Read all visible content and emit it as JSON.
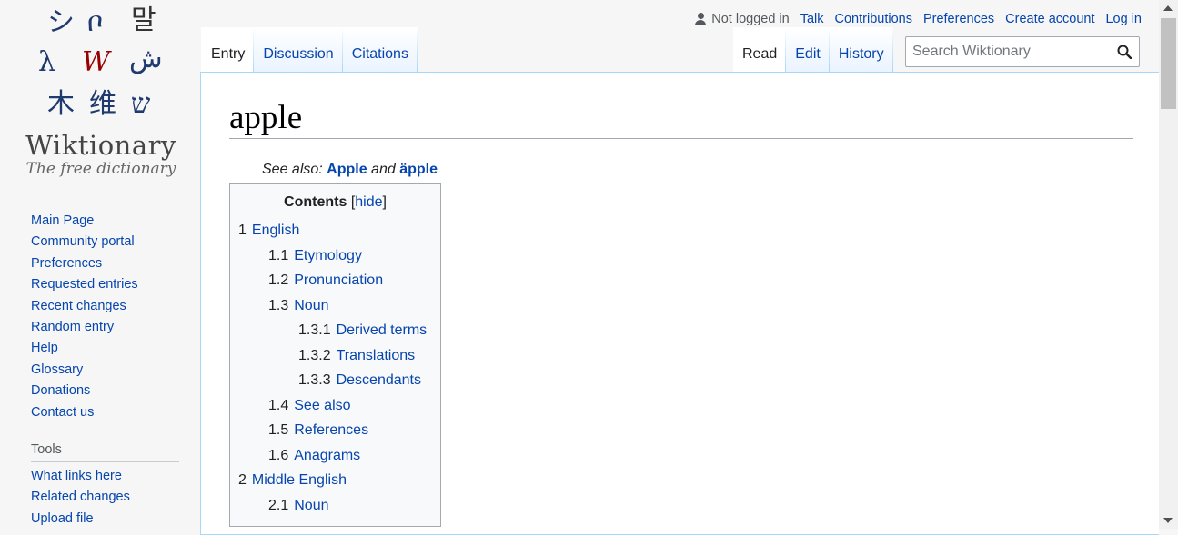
{
  "logo": {
    "glyphs": [
      "シ",
      "ቦ",
      "말",
      "λ",
      "W",
      "ش",
      "木",
      "维",
      "ש"
    ],
    "wordmark": "Wiktionary",
    "tagline": "The free dictionary"
  },
  "sidebar": {
    "navigation": [
      "Main Page",
      "Community portal",
      "Preferences",
      "Requested entries",
      "Recent changes",
      "Random entry",
      "Help",
      "Glossary",
      "Donations",
      "Contact us"
    ],
    "tools_heading": "Tools",
    "tools": [
      "What links here",
      "Related changes",
      "Upload file"
    ]
  },
  "personal": {
    "status": "Not logged in",
    "links": [
      "Talk",
      "Contributions",
      "Preferences",
      "Create account",
      "Log in"
    ]
  },
  "tabs": {
    "left": [
      "Entry",
      "Discussion",
      "Citations"
    ],
    "right": [
      "Read",
      "Edit",
      "History"
    ]
  },
  "search": {
    "placeholder": "Search Wiktionary"
  },
  "page": {
    "title": "apple",
    "hatnote_prefix": "See also: ",
    "hatnote_link1": "Apple",
    "hatnote_mid": " and ",
    "hatnote_link2": "äpple"
  },
  "toc": {
    "title": "Contents",
    "hide_open": "[",
    "hide_label": "hide",
    "hide_close": "]",
    "items": [
      {
        "num": "1",
        "label": "English"
      },
      {
        "num": "1.1",
        "label": "Etymology"
      },
      {
        "num": "1.2",
        "label": "Pronunciation"
      },
      {
        "num": "1.3",
        "label": "Noun"
      },
      {
        "num": "1.3.1",
        "label": "Derived terms"
      },
      {
        "num": "1.3.2",
        "label": "Translations"
      },
      {
        "num": "1.3.3",
        "label": "Descendants"
      },
      {
        "num": "1.4",
        "label": "See also"
      },
      {
        "num": "1.5",
        "label": "References"
      },
      {
        "num": "1.6",
        "label": "Anagrams"
      },
      {
        "num": "2",
        "label": "Middle English"
      },
      {
        "num": "2.1",
        "label": "Noun"
      }
    ]
  },
  "colors": {
    "link": "#0645ad",
    "text": "#202122",
    "glyph_red": "#990000",
    "glyph_navy": "#1f3a6e"
  }
}
